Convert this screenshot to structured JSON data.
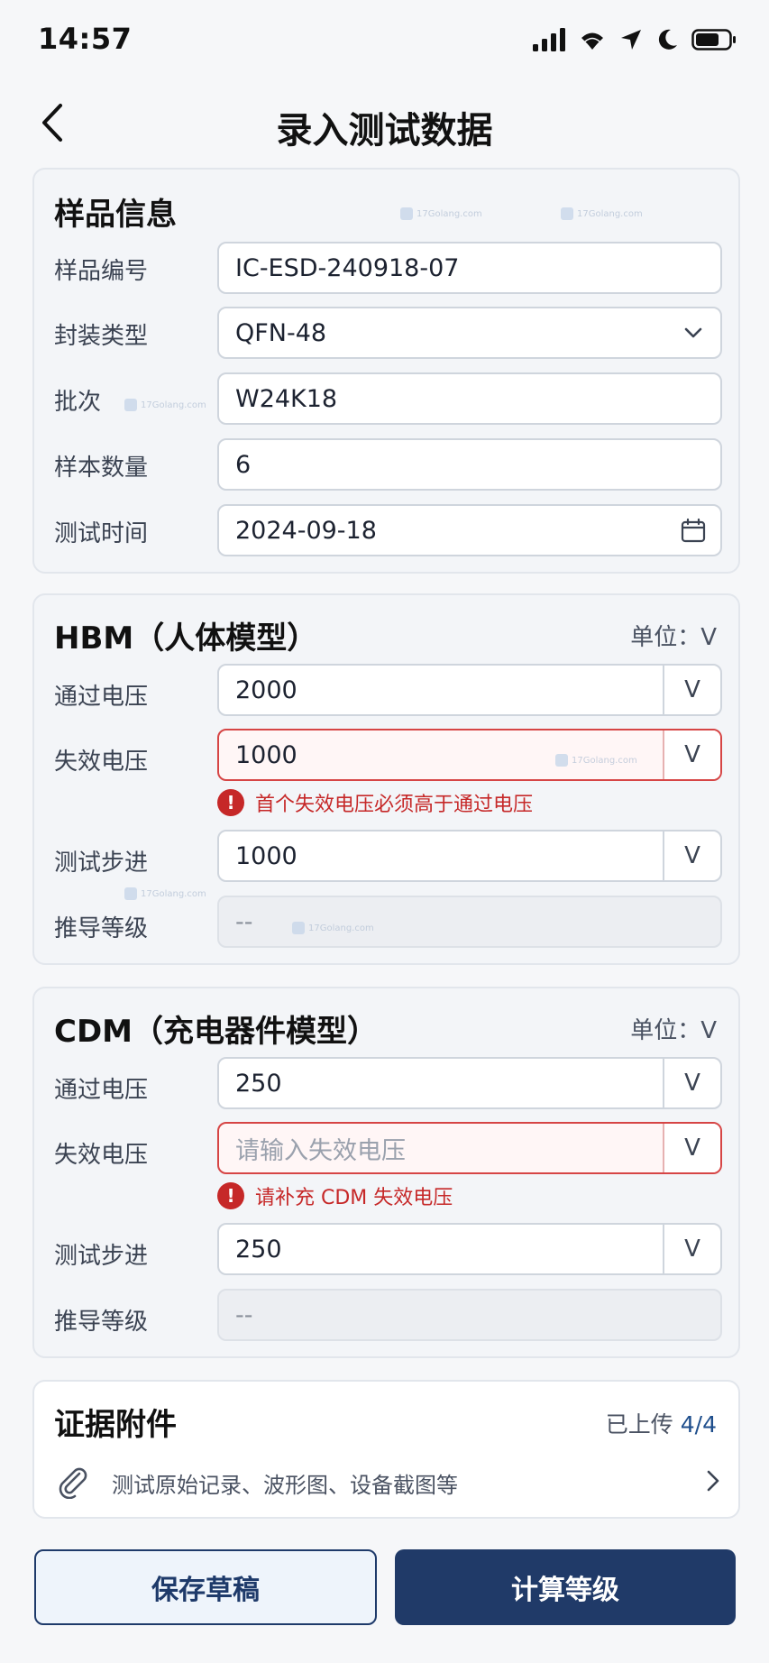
{
  "status_bar": {
    "time": "14:57"
  },
  "nav": {
    "title": "录入测试数据"
  },
  "sample_info": {
    "title": "样品信息",
    "fields": {
      "sample_id": {
        "label": "样品编号",
        "value": "IC-ESD-240918-07"
      },
      "package_type": {
        "label": "封装类型",
        "value": "QFN-48"
      },
      "batch": {
        "label": "批次",
        "value": "W24K18"
      },
      "sample_qty": {
        "label": "样本数量",
        "value": "6"
      },
      "test_date": {
        "label": "测试时间",
        "value": "2024-09-18"
      }
    }
  },
  "hbm": {
    "title": "HBM（人体模型）",
    "unit_label": "单位：V",
    "pass_voltage": {
      "label": "通过电压",
      "value": "2000",
      "unit": "V"
    },
    "fail_voltage": {
      "label": "失效电压",
      "value": "1000",
      "unit": "V",
      "error": "首个失效电压必须高于通过电压"
    },
    "step": {
      "label": "测试步进",
      "value": "1000",
      "unit": "V"
    },
    "grade": {
      "label": "推导等级",
      "value": "--"
    }
  },
  "cdm": {
    "title": "CDM（充电器件模型）",
    "unit_label": "单位：V",
    "pass_voltage": {
      "label": "通过电压",
      "value": "250",
      "unit": "V"
    },
    "fail_voltage": {
      "label": "失效电压",
      "placeholder": "请输入失效电压",
      "unit": "V",
      "error": "请补充 CDM 失效电压"
    },
    "step": {
      "label": "测试步进",
      "value": "250",
      "unit": "V"
    },
    "grade": {
      "label": "推导等级",
      "value": "--"
    }
  },
  "attachments": {
    "title": "证据附件",
    "uploaded_label": "已上传",
    "uploaded_count": "4/4",
    "hint": "测试原始记录、波形图、设备截图等"
  },
  "actions": {
    "save_draft": "保存草稿",
    "calculate": "计算等级"
  },
  "watermark": {
    "text": "17Golang.com"
  },
  "colors": {
    "primary": "#203a68",
    "error": "#c62828",
    "accent_blue": "#1e4e8c"
  }
}
